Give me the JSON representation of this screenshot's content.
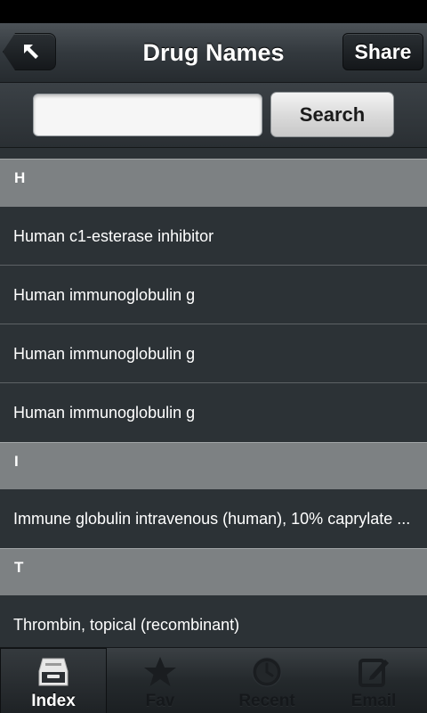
{
  "header": {
    "title": "Drug Names",
    "share_label": "Share",
    "back_icon": "back-arrow-icon"
  },
  "search": {
    "value": "",
    "placeholder": "",
    "button_label": "Search"
  },
  "list": {
    "sections": [
      {
        "letter": "H",
        "items": [
          "Human c1-esterase inhibitor",
          "Human immunoglobulin g",
          "Human immunoglobulin g",
          "Human immunoglobulin g"
        ]
      },
      {
        "letter": "I",
        "items": [
          "Immune globulin intravenous (human), 10% caprylate ..."
        ]
      },
      {
        "letter": "T",
        "items": [
          "Thrombin, topical (recombinant)"
        ]
      }
    ]
  },
  "tabs": [
    {
      "label": "Index",
      "icon": "inbox-tray-icon",
      "active": true
    },
    {
      "label": "Fav",
      "icon": "star-icon",
      "active": false
    },
    {
      "label": "Recent",
      "icon": "clock-icon",
      "active": false
    },
    {
      "label": "Email",
      "icon": "compose-icon",
      "active": false
    }
  ],
  "colors": {
    "section_header_bg": "#7d8183",
    "row_bg": "#2c3236",
    "active_tab_label": "#ffffff",
    "inactive_tab_label": "#15181b"
  }
}
